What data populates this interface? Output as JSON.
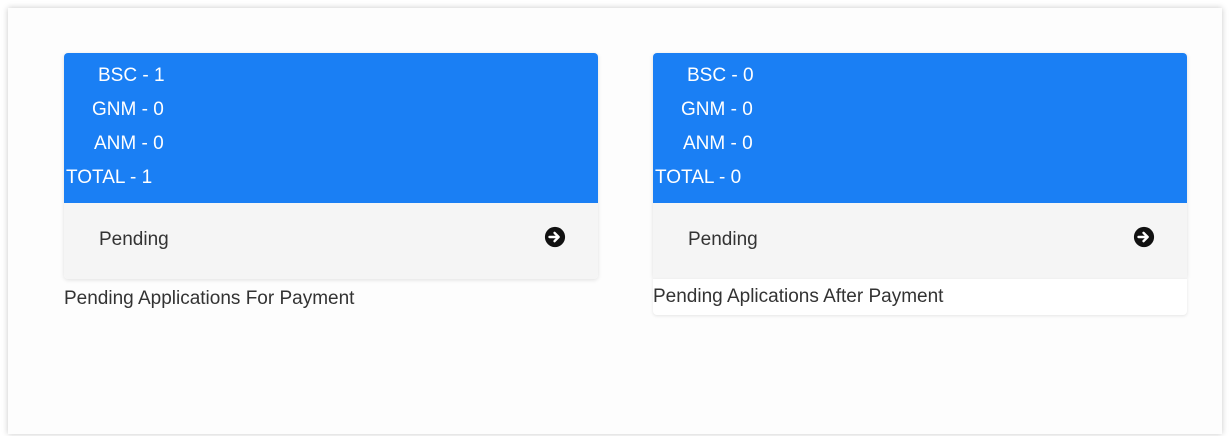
{
  "colors": {
    "card_header": "#1a7ff4",
    "card_footer": "#f5f5f5",
    "text": "#333333"
  },
  "cards": [
    {
      "lines": {
        "bsc": "BSC - 1",
        "gnm": "GNM - 0",
        "anm": "ANM - 0",
        "total": "TOTAL - 1"
      },
      "footer_label": "Pending",
      "icon": "arrow-circle-right-icon",
      "caption": "Pending Applications For Payment"
    },
    {
      "lines": {
        "bsc": "BSC - 0",
        "gnm": "GNM - 0",
        "anm": "ANM - 0",
        "total": "TOTAL - 0"
      },
      "footer_label": "Pending",
      "icon": "arrow-circle-right-icon",
      "caption": "Pending Aplications After Payment"
    }
  ]
}
